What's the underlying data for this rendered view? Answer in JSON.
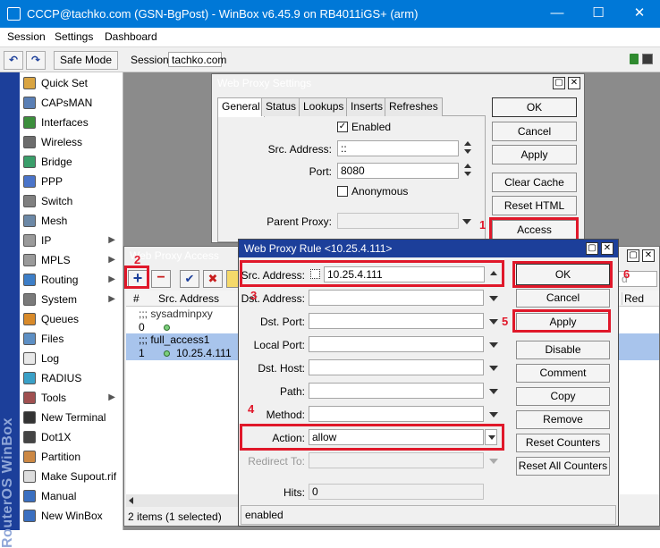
{
  "window": {
    "title": "CCCP@tachko.com (GSN-BgPost) - WinBox v6.45.9 on RB4011iGS+ (arm)",
    "minimize": "—",
    "maximize": "☐",
    "close": "✕"
  },
  "menu": [
    "Session",
    "Settings",
    "Dashboard"
  ],
  "toolbar": {
    "undo": "↶",
    "redo": "↷",
    "safe_mode": "Safe Mode",
    "session_label": "Session:",
    "session_value": "tachko.com"
  },
  "sidebar": {
    "brand": "RouterOS WinBox",
    "items": [
      {
        "label": "Quick Set",
        "icon": "quickset-icon",
        "color": "#d9a441"
      },
      {
        "label": "CAPsMAN",
        "icon": "capsman-icon",
        "color": "#5a7fb5"
      },
      {
        "label": "Interfaces",
        "icon": "interfaces-icon",
        "color": "#3c8f3c"
      },
      {
        "label": "Wireless",
        "icon": "wireless-icon",
        "color": "#6c6c6c"
      },
      {
        "label": "Bridge",
        "icon": "bridge-icon",
        "color": "#3a9e6a"
      },
      {
        "label": "PPP",
        "icon": "ppp-icon",
        "color": "#4a74c9"
      },
      {
        "label": "Switch",
        "icon": "switch-icon",
        "color": "#808080"
      },
      {
        "label": "Mesh",
        "icon": "mesh-icon",
        "color": "#6c88a6"
      },
      {
        "label": "IP",
        "icon": "ip-icon",
        "color": "#9a9a9a",
        "arrow": "▶"
      },
      {
        "label": "MPLS",
        "icon": "mpls-icon",
        "color": "#9a9a9a",
        "arrow": "▶"
      },
      {
        "label": "Routing",
        "icon": "routing-icon",
        "color": "#3d7ec7",
        "arrow": "▶"
      },
      {
        "label": "System",
        "icon": "system-icon",
        "color": "#7a7a7a",
        "arrow": "▶"
      },
      {
        "label": "Queues",
        "icon": "queues-icon",
        "color": "#d88a2a"
      },
      {
        "label": "Files",
        "icon": "files-icon",
        "color": "#5d8fc4"
      },
      {
        "label": "Log",
        "icon": "log-icon",
        "color": "#e8e8e8"
      },
      {
        "label": "RADIUS",
        "icon": "radius-icon",
        "color": "#3aa0c7"
      },
      {
        "label": "Tools",
        "icon": "tools-icon",
        "color": "#a05050",
        "arrow": "▶"
      },
      {
        "label": "New Terminal",
        "icon": "terminal-icon",
        "color": "#333333"
      },
      {
        "label": "Dot1X",
        "icon": "dot1x-icon",
        "color": "#444444"
      },
      {
        "label": "Partition",
        "icon": "partition-icon",
        "color": "#cc8844"
      },
      {
        "label": "Make Supout.rif",
        "icon": "supout-icon",
        "color": "#dddddd"
      },
      {
        "label": "Manual",
        "icon": "manual-icon",
        "color": "#3a6fc0"
      },
      {
        "label": "New WinBox",
        "icon": "winbox-icon",
        "color": "#3a6fc0"
      }
    ]
  },
  "proxy_settings": {
    "title": "Web Proxy Settings",
    "tabs": [
      "General",
      "Status",
      "Lookups",
      "Inserts",
      "Refreshes"
    ],
    "enabled_label": "Enabled",
    "src_address_label": "Src. Address:",
    "src_address_value": "::",
    "port_label": "Port:",
    "port_value": "8080",
    "anonymous_label": "Anonymous",
    "parent_proxy_label": "Parent Proxy:",
    "buttons": [
      "OK",
      "Cancel",
      "Apply",
      "Clear Cache",
      "Reset HTML",
      "Access"
    ]
  },
  "proxy_access": {
    "title": "Web Proxy Access",
    "col_num": "#",
    "col_src": "Src. Address",
    "col_red": "Red",
    "search_placeholder": "d",
    "rows": [
      {
        "text": ";;; sysadminpxy"
      },
      {
        "num": "0",
        "text": ""
      },
      {
        "text": ";;; full_access1"
      },
      {
        "num": "1",
        "text": "10.25.4.111"
      }
    ],
    "status": "2 items (1 selected)"
  },
  "proxy_rule": {
    "title": "Web Proxy Rule <10.25.4.111>",
    "src_address_label": "Src. Address:",
    "src_address_value": "10.25.4.111",
    "dst_address_label": "Dst. Address:",
    "dst_port_label": "Dst. Port:",
    "local_port_label": "Local Port:",
    "dst_host_label": "Dst. Host:",
    "path_label": "Path:",
    "method_label": "Method:",
    "action_label": "Action:",
    "action_value": "allow",
    "redirect_label": "Redirect To:",
    "hits_label": "Hits:",
    "hits_value": "0",
    "status": "enabled",
    "buttons": [
      "OK",
      "Cancel",
      "Apply",
      "Disable",
      "Comment",
      "Copy",
      "Remove",
      "Reset Counters",
      "Reset All Counters"
    ]
  },
  "annotations": [
    "1",
    "2",
    "3",
    "4",
    "5",
    "6"
  ]
}
